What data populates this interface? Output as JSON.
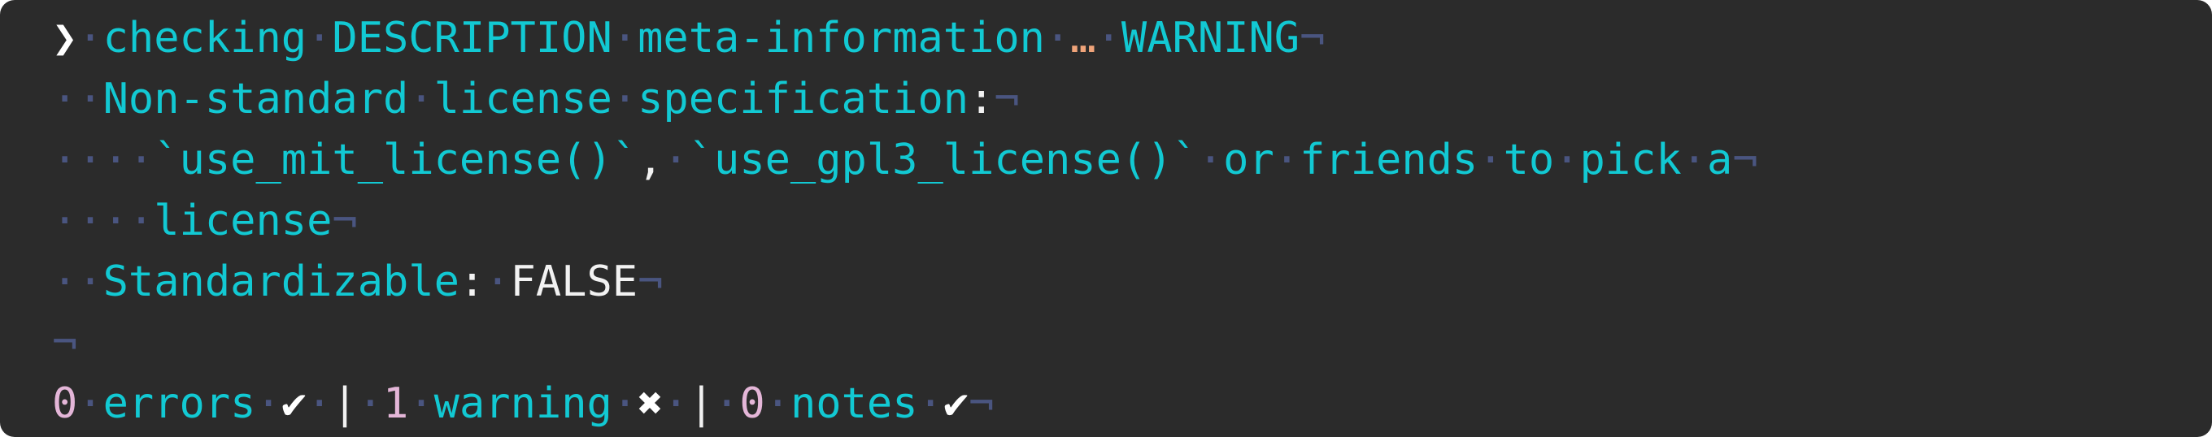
{
  "window": {
    "app_title": ""
  },
  "lines": [
    {
      "prompt": "❯",
      "checking": "checking",
      "description": "DESCRIPTION",
      "meta": "meta-information",
      "ellipsis": "…",
      "status": "WARNING"
    },
    {
      "heading": "Non-standard",
      "word_license": "license",
      "word_spec": "specification",
      "colon": ":"
    },
    {
      "fn_mit": "`use_mit_license()`",
      "comma": ",",
      "fn_gpl": "`use_gpl3_license()`",
      "w_or": "or",
      "w_friends": "friends",
      "w_to": "to",
      "w_pick": "pick",
      "w_a": "a"
    },
    {
      "w_license": "license"
    },
    {
      "key": "Standardizable",
      "colon": ":",
      "value": "FALSE"
    },
    {},
    {
      "errors_count": "0",
      "errors_label": "errors",
      "errors_mark": "✔",
      "sep1": "|",
      "warnings_count": "1",
      "warnings_label": "warning",
      "warnings_mark": "✖",
      "sep2": "|",
      "notes_count": "0",
      "notes_label": "notes",
      "notes_mark": "✔"
    }
  ],
  "glyphs": {
    "space_dot": "·",
    "eol": "¬"
  },
  "colors": {
    "background": "#2b2b2b",
    "text_cyan": "#12c9d3",
    "whitespace": "#4a5580",
    "orange": "#f0a47a",
    "pink": "#e4b6d8",
    "white": "#f2f2f2"
  }
}
